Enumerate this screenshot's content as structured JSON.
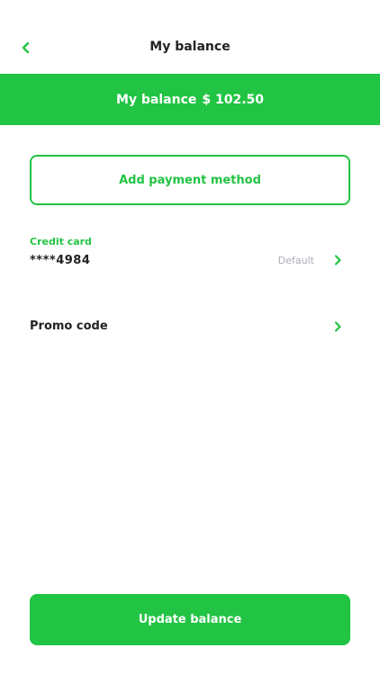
{
  "colors": {
    "accent": "#22c444",
    "muted": "#a9adb4",
    "text": "#222222"
  },
  "header": {
    "title": "My balance",
    "back_icon": "chevron-left-icon"
  },
  "balance": {
    "label": "My balance",
    "amount": "$ 102.50"
  },
  "actions": {
    "add_payment_label": "Add payment method",
    "update_label": "Update balance"
  },
  "credit_card": {
    "label": "Credit card",
    "masked_prefix": "****",
    "last_digits": "4984",
    "status": "Default",
    "chevron_icon": "chevron-right-icon"
  },
  "promo": {
    "label": "Promo code",
    "chevron_icon": "chevron-right-icon"
  }
}
